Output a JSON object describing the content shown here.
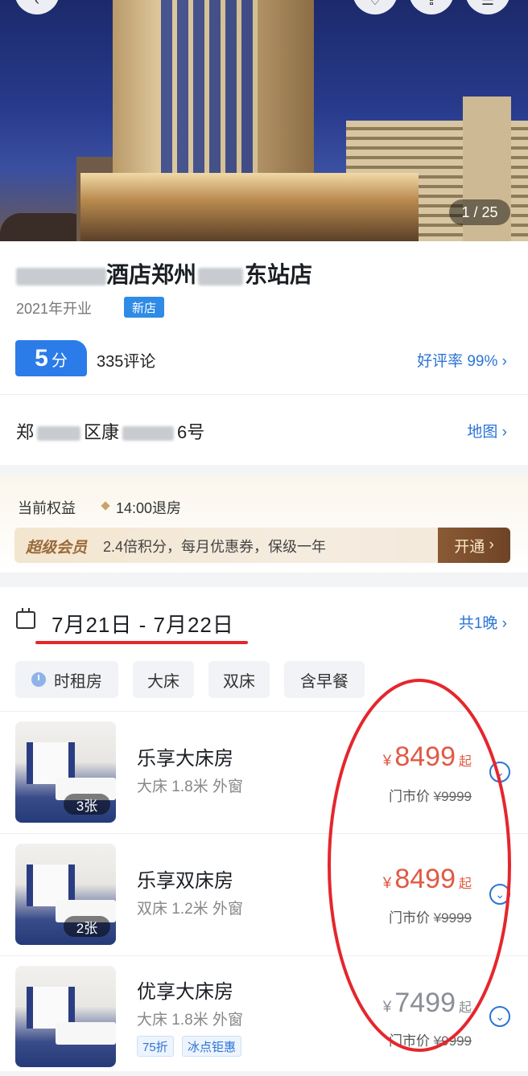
{
  "hero": {
    "photo_counter": "1 / 25",
    "icons": [
      "back-icon",
      "favorite-icon",
      "share-icon",
      "more-icon"
    ]
  },
  "hotel": {
    "name_part1": "酒店郑州",
    "name_part2": "东站店",
    "open_year": "2021年开业",
    "new_badge": "新店",
    "score": "5",
    "score_unit": "分",
    "reviews": "335评论",
    "good_rate": "好评率 99%",
    "address_prefix": "郑",
    "address_mid": "区康",
    "address_suffix": "6号",
    "map_link": "地图"
  },
  "perks": {
    "title": "当前权益",
    "item": "14:00退房",
    "vip_tag": "超级会员",
    "vip_desc": "2.4倍积分，每月优惠券，保级一年",
    "vip_button": "开通"
  },
  "booking": {
    "dates": "7月21日 - 7月22日",
    "nights": "共1晚",
    "filters": [
      "时租房",
      "大床",
      "双床",
      "含早餐"
    ]
  },
  "rooms": [
    {
      "name": "乐享大床房",
      "desc": "大床 1.8米  外窗",
      "photos": "3张",
      "currency": "¥",
      "price": "8499",
      "suffix": "起",
      "orig_label": "门市价",
      "orig_price": "¥9999"
    },
    {
      "name": "乐享双床房",
      "desc": "双床 1.2米  外窗",
      "photos": "2张",
      "currency": "¥",
      "price": "8499",
      "suffix": "起",
      "orig_label": "门市价",
      "orig_price": "¥9999"
    },
    {
      "name": "优享大床房",
      "desc": "大床 1.8米  外窗",
      "photos": "",
      "currency": "¥",
      "price": "7499",
      "suffix": "起",
      "orig_label": "门市价",
      "orig_price": "¥9999",
      "discounts": [
        "75折",
        "冰点钜惠"
      ]
    }
  ],
  "colors": {
    "accent_blue": "#2b74d6",
    "price_red": "#e05a45",
    "price_gray": "#8a8f96",
    "annotation_red": "#e5262d"
  }
}
